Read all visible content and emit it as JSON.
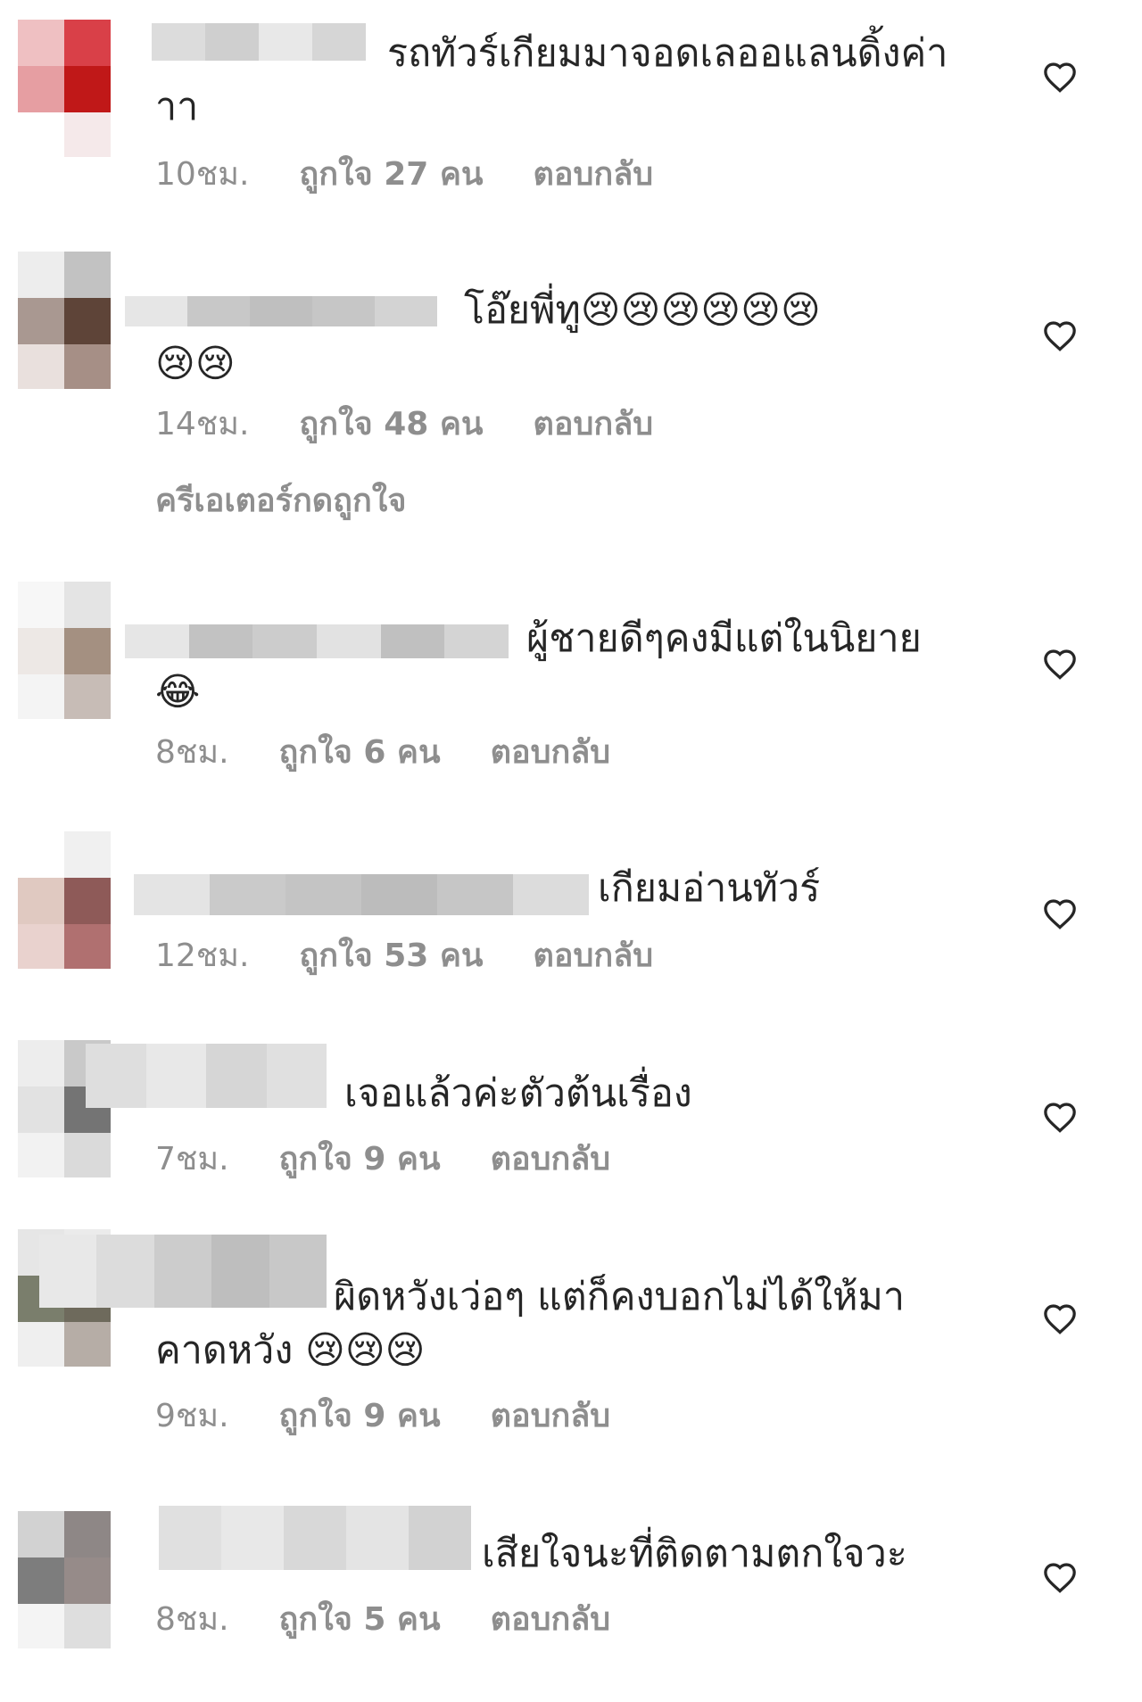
{
  "colors": {
    "text_primary": "#262626",
    "text_secondary": "#8e8e8e",
    "heart_outline": "#262626"
  },
  "icons": {
    "like": "heart-outline-icon"
  },
  "comments": [
    {
      "text": "รถทัวร์เกียมมาจอดเลออแลนดิ้งค่า\nาา",
      "time": "10ชม.",
      "likes": "ถูกใจ 27 คน",
      "reply": "ตอบกลับ"
    },
    {
      "text": "โอ๊ยพี่ทู😢😢😢😢😢😢\n😢😢",
      "time": "14ชม.",
      "likes": "ถูกใจ 48 คน",
      "reply": "ตอบกลับ",
      "creator_liked": "ครีเอเตอร์กดถูกใจ"
    },
    {
      "text": "ผู้ชายดีๆคงมีแต่ในนิยาย\n😂",
      "time": "8ชม.",
      "likes": "ถูกใจ 6 คน",
      "reply": "ตอบกลับ"
    },
    {
      "text": "เกียมอ่านทัวร์",
      "time": "12ชม.",
      "likes": "ถูกใจ 53 คน",
      "reply": "ตอบกลับ"
    },
    {
      "text": "เจอแล้วค่ะตัวต้นเรื่อง",
      "time": "7ชม.",
      "likes": "ถูกใจ 9 คน",
      "reply": "ตอบกลับ"
    },
    {
      "text": "ผิดหวังเว่อๆ แต่ก็คงบอกไม่ได้ให้มา\nคาดหวัง 😢😢😢",
      "time": "9ชม.",
      "likes": "ถูกใจ 9 คน",
      "reply": "ตอบกลับ"
    },
    {
      "text": "เสียใจนะที่ติดตามตกใจวะ",
      "time": "8ชม.",
      "likes": "ถูกใจ 5 คน",
      "reply": "ตอบกลับ"
    }
  ]
}
